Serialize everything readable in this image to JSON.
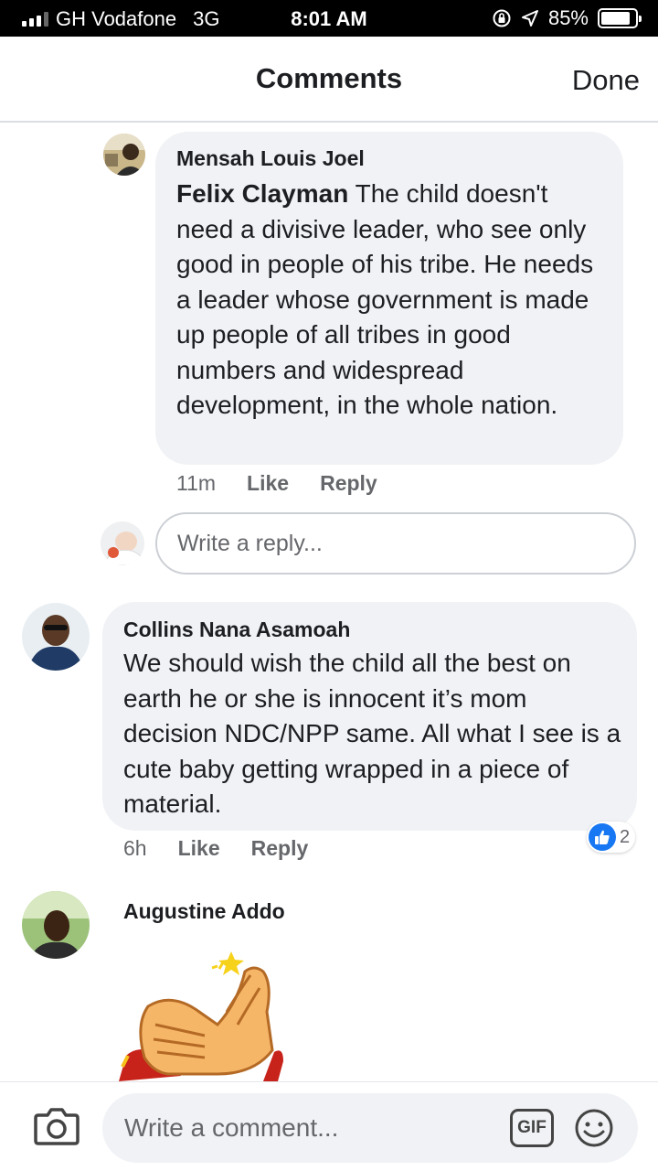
{
  "status_bar": {
    "carrier": "GH Vodafone",
    "network": "3G",
    "time": "8:01 AM",
    "battery": "85%",
    "battery_level": 0.85
  },
  "header": {
    "title": "Comments",
    "done_label": "Done"
  },
  "comments": [
    {
      "author": "Mensah Louis Joel",
      "mention": "Felix Clayman",
      "text": "The child doesn't need a divisive leader, who see only good in people of his tribe. He needs a leader whose government is made up people of all tribes in good numbers and widespread development, in the whole nation.",
      "time": "11m",
      "like_label": "Like",
      "reply_label": "Reply"
    },
    {
      "author": "Collins Nana Asamoah",
      "text": "We should wish the child all the best on earth he or she is innocent it’s mom decision NDC/NPP same. All what I see is a cute baby getting wrapped in a piece of material.",
      "time": "6h",
      "like_label": "Like",
      "reply_label": "Reply",
      "reaction_count": "2"
    },
    {
      "author": "Augustine Addo",
      "sticker": "clapping-hands-sticker"
    }
  ],
  "reply_box": {
    "placeholder": "Write a reply..."
  },
  "composer": {
    "placeholder": "Write a comment...",
    "gif_label": "GIF"
  },
  "colors": {
    "bubble": "#f0f2f5",
    "accent": "#1877f2",
    "muted_text": "#65676b"
  }
}
